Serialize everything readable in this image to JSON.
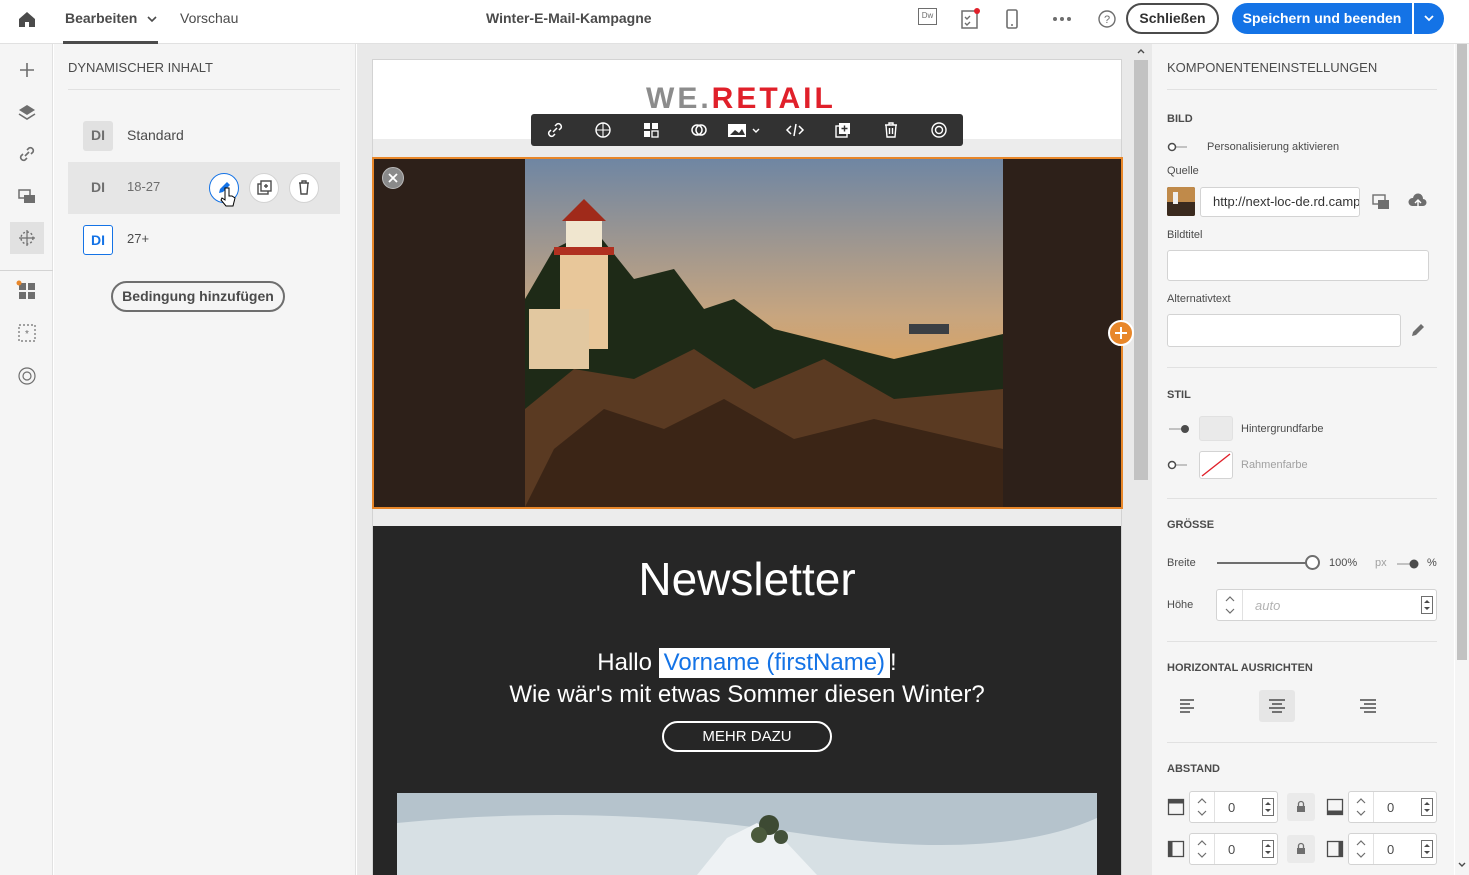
{
  "topbar": {
    "tab_edit": "Bearbeiten",
    "tab_preview": "Vorschau",
    "campaign_title": "Winter-E-Mail-Kampagne",
    "dw_label": "Dw",
    "close_label": "Schließen",
    "save_label": "Speichern und beenden"
  },
  "left_panel": {
    "title": "DYNAMISCHER INHALT",
    "items": [
      {
        "badge": "DI",
        "label": "Standard"
      },
      {
        "badge": "DI",
        "label": "18-27"
      },
      {
        "badge": "DI",
        "label": "27+"
      }
    ],
    "add_condition_label": "Bedingung hinzufügen"
  },
  "email": {
    "logo_part1": "WE.",
    "logo_part2": "RETAIL",
    "newsletter_title": "Newsletter",
    "greeting": "Hallo",
    "personalization": "Vorname (firstName)",
    "exclamation": "!",
    "subline": "Wie wär's mit etwas Sommer diesen Winter?",
    "more_button": "MEHR DAZU"
  },
  "right_panel": {
    "title": "KOMPONENTENEINSTELLUNGEN",
    "section_image": "BILD",
    "personalize_label": "Personalisierung aktivieren",
    "source_label": "Quelle",
    "source_value": "http://next-loc-de.rd.campaign.adobe.com",
    "image_title_label": "Bildtitel",
    "alt_text_label": "Alternativtext",
    "section_style": "STIL",
    "bg_color_label": "Hintergrundfarbe",
    "border_color_label": "Rahmenfarbe",
    "section_size": "GRÖSSE",
    "width_label": "Breite",
    "width_value": "100%",
    "width_percent": 100,
    "unit_px": "px",
    "unit_percent": "%",
    "height_label": "Höhe",
    "height_placeholder": "auto",
    "section_align": "HORIZONTAL AUSRICHTEN",
    "section_spacing": "ABSTAND",
    "spacing_top": "0",
    "spacing_bottom": "0",
    "spacing_left": "0",
    "spacing_right": "0"
  },
  "colors": {
    "accent": "#1473e6",
    "selection": "#e8872a",
    "logo_red": "#e0202a",
    "logo_gray": "#8c8c8c"
  },
  "icons": [
    "home-icon",
    "chevron-down-icon",
    "dreamweaver-icon",
    "checklist-icon",
    "mobile-icon",
    "more-icon",
    "help-icon",
    "plus-icon",
    "layers-icon",
    "link-icon",
    "fragments-icon",
    "dynamic-content-icon",
    "components-icon",
    "personalization-icon",
    "target-icon",
    "edit-icon",
    "duplicate-icon",
    "delete-icon",
    "close-icon",
    "add-icon",
    "upload-icon",
    "pencil-icon",
    "lock-icon",
    "align-left-icon",
    "align-center-icon",
    "align-right-icon"
  ]
}
